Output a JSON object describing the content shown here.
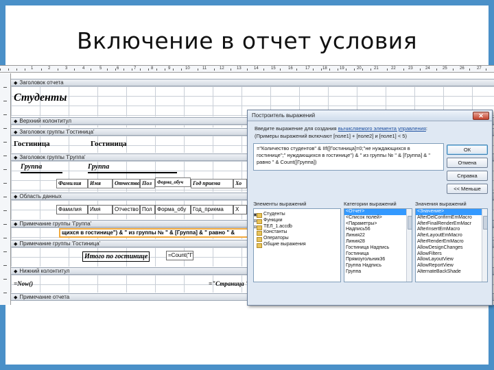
{
  "slide": {
    "title": "Включение в отчет условия"
  },
  "ruler": {
    "numbers": [
      "1",
      "2",
      "3",
      "4",
      "5",
      "6",
      "7",
      "8",
      "9",
      "10",
      "11",
      "12",
      "13",
      "14",
      "15",
      "16",
      "17",
      "18",
      "19",
      "20",
      "21",
      "22",
      "23",
      "24",
      "25",
      "26",
      "27",
      "28"
    ]
  },
  "report": {
    "sections": {
      "report_header": "Заголовок отчета",
      "page_header": "Верхний колонтитул",
      "group_header_hostel": "Заголовок группы 'Гостиница'",
      "group_header_group": "Заголовок группы 'Группа'",
      "detail": "Область данных",
      "group_footer_group": "Примечание группы 'Группа'",
      "group_footer_hostel": "Примечание группы 'Гостиница'",
      "page_footer": "Нижний колонтитул",
      "report_footer": "Примечание отчета"
    },
    "report_title": "Студенты",
    "hostel_label": "Гостиница",
    "hostel_value": "Гостиница",
    "group_label": "Группа",
    "group_value": "Группа",
    "column_labels": [
      "Фамилия",
      "Имя",
      "Отчество",
      "Пол",
      "Форма_обуч",
      "Год приема",
      "Хо"
    ],
    "detail_fields": [
      "Фамилия",
      "Имя",
      "Отчество",
      "Пол",
      "Форма_обу",
      "Год_приема",
      "Х"
    ],
    "group_footer_expr": "щихся в гостинице\") & \" из группы №  \" & [Группа] & \" равно  \" &",
    "hostel_footer_label": "Итого по гостинице",
    "hostel_footer_expr": "=Count(\"Г",
    "page_footer_left": "=Now()",
    "page_footer_right": "=\"Страница \" &"
  },
  "dialog": {
    "title": "Построитель выражений",
    "hint_prefix": "Введите выражение для создания ",
    "hint_link": "вычисляемого элемента управления",
    "hint_suffix": ":",
    "hint_example": "(Примеры выражений включают [поле1] + [поле2] и [поле1] < 5)",
    "expression": "=\"Количество студентов\" & IIf([Гостиница]=0;\"не нуждающихся в гостинице\";\" нуждающихся в гостинице\") & \" из группы №  \" & [Группа] & \" равно  \" & Count([Группа])",
    "buttons": {
      "ok": "ОК",
      "cancel": "Отмена",
      "help": "Справка",
      "less": "<< Меньше"
    },
    "columns": {
      "elements": "Элементы выражений",
      "categories": "Категории выражений",
      "values": "Значения выражений"
    },
    "elements": [
      "Студенты",
      "Функции",
      "ТЕЛ_1.accdb",
      "Константы",
      "Операторы",
      "Общие выражения"
    ],
    "categories": [
      "<Отчет>",
      "<Список полей>",
      "<Параметры>",
      "Надпись56",
      "Линия22",
      "Линия28",
      "Гостиница Надпись",
      "Гостиница",
      "Прямоугольник36",
      "Группа Надпись",
      "Группа"
    ],
    "values": [
      "<Значение>",
      "AfterDelConfirmEmMacro",
      "AfterFinalRenderEmMacr",
      "AfterInsertEmMacro",
      "AfterLayoutEmMacro",
      "AfterRenderEmMacro",
      "AllowDesignChanges",
      "AllowFilters",
      "AllowLayoutView",
      "AllowReportView",
      "AlternateBackShade"
    ]
  }
}
